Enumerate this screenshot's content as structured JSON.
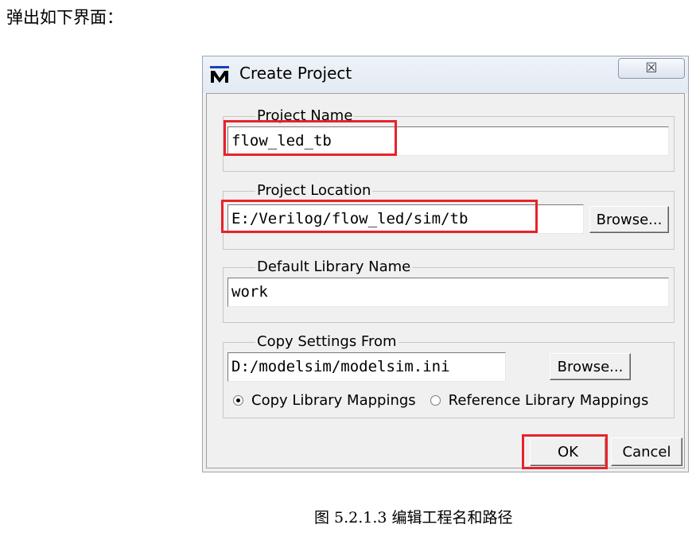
{
  "intro_text": "弹出如下界面：",
  "caption": "图  5.2.1.3  编辑工程名和路径",
  "dialog": {
    "title": "Create Project",
    "close_glyph": "☒",
    "project_name": {
      "legend": "Project Name",
      "value": "flow_led_tb"
    },
    "project_location": {
      "legend": "Project Location",
      "value": "E:/Verilog/flow_led/sim/tb",
      "browse_label": "Browse..."
    },
    "default_library": {
      "legend": "Default Library Name",
      "value": "work"
    },
    "copy_settings": {
      "legend": "Copy Settings From",
      "value": "D:/modelsim/modelsim.ini",
      "browse_label": "Browse...",
      "option_copy": "Copy Library Mappings",
      "option_reference": "Reference Library Mappings",
      "selected": "copy"
    },
    "ok_label": "OK",
    "cancel_label": "Cancel"
  },
  "colors": {
    "highlight": "#e8222b",
    "dialog_bg": "#f0f0f0"
  }
}
